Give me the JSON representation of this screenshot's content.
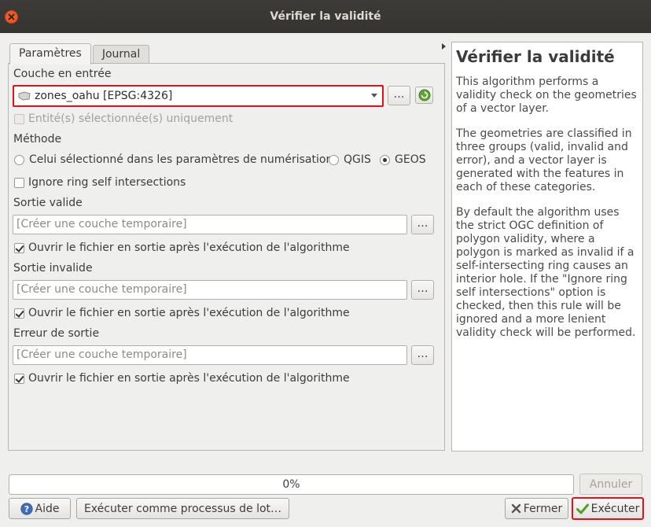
{
  "window": {
    "title": "Vérifier la validité"
  },
  "tabs": [
    {
      "label": "Paramètres"
    },
    {
      "label": "Journal"
    }
  ],
  "form": {
    "input_layer_label": "Couche en entrée",
    "input_layer_value": "zones_oahu [EPSG:4326]",
    "selected_only_label": "Entité(s) sélectionnée(s) uniquement",
    "method_label": "Méthode",
    "method_options": [
      {
        "label": "Celui sélectionné dans les paramètres de numérisation",
        "checked": false
      },
      {
        "label": "QGIS",
        "checked": false
      },
      {
        "label": "GEOS",
        "checked": true
      }
    ],
    "ignore_ring_label": "Ignore ring self intersections",
    "outputs": [
      {
        "label": "Sortie valide",
        "placeholder": "[Créer une couche temporaire]",
        "open_label": "Ouvrir le fichier en sortie après l'exécution de l'algorithme"
      },
      {
        "label": "Sortie invalide",
        "placeholder": "[Créer une couche temporaire]",
        "open_label": "Ouvrir le fichier en sortie après l'exécution de l'algorithme"
      },
      {
        "label": "Erreur de sortie",
        "placeholder": "[Créer une couche temporaire]",
        "open_label": "Ouvrir le fichier en sortie après l'exécution de l'algorithme"
      }
    ],
    "browse_label": "…"
  },
  "help": {
    "title": "Vérifier la validité",
    "paragraphs": [
      "This algorithm performs a validity check on the geometries of a vector layer.",
      "The geometries are classified in three groups (valid, invalid and error), and a vector layer is generated with the features in each of these categories.",
      "By default the algorithm uses the strict OGC definition of polygon validity, where a polygon is marked as invalid if a self-intersecting ring causes an interior hole. If the \"Ignore ring self intersections\" option is checked, then this rule will be ignored and a more lenient validity check will be performed."
    ]
  },
  "progress": {
    "text": "0%",
    "value": 0
  },
  "buttons": {
    "cancel": "Annuler",
    "help": "Aide",
    "batch": "Exécuter comme processus de lot…",
    "close": "Fermer",
    "run": "Exécuter"
  },
  "colors": {
    "highlight": "#e2111b",
    "titlebar": "#3c3b37",
    "close": "#ea5a2b"
  }
}
